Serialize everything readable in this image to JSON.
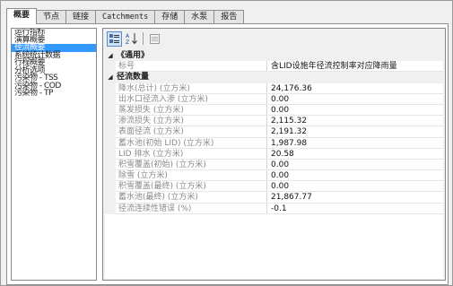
{
  "tabs": [
    "概要",
    "节点",
    "链接",
    "Catchments",
    "存储",
    "水泵",
    "报告"
  ],
  "active_tab_index": 0,
  "left_list": {
    "items": [
      "运行指标",
      "演算概要",
      "径流概要",
      "系统统计数据",
      "行程概要",
      "分析选项",
      "污染物 - TSS",
      "污染物 - COD",
      "污染物 - TP"
    ],
    "selected_index": 2
  },
  "toolbar": {
    "categorized_icon": "categorized-view-icon",
    "alpha_icon": "alphabetical-sort-icon",
    "pages_icon": "property-pages-icon",
    "alpha_glyph": "A↓Z"
  },
  "grid": {
    "cat_general": "《通用》",
    "cat_runoff": "径流数量",
    "rows": [
      {
        "label": "标号",
        "value": "含LID设施年径流控制率对应降雨量"
      },
      {
        "label": "降水(总计) (立方米)",
        "value": "24,176.36"
      },
      {
        "label": "出水口径流入渗 (立方米)",
        "value": "0.00"
      },
      {
        "label": "蒸发损失 (立方米)",
        "value": "0.00"
      },
      {
        "label": "渗流损失 (立方米)",
        "value": "2,115.32"
      },
      {
        "label": "表面径流 (立方米)",
        "value": "2,191.32"
      },
      {
        "label": "蓄水池(初始 LID) (立方米)",
        "value": "1,987.98"
      },
      {
        "label": "LID 排水 (立方米)",
        "value": "20.58"
      },
      {
        "label": "积雪覆盖(初始) (立方米)",
        "value": "0.00"
      },
      {
        "label": "除雪 (立方米)",
        "value": "0.00"
      },
      {
        "label": "积雪覆盖(最终) (立方米)",
        "value": "0.00"
      },
      {
        "label": "蓄水池(最终) (立方米)",
        "value": "21,867.77"
      },
      {
        "label": "径流连续性错误 (%)",
        "value": "-0.1"
      }
    ]
  },
  "colors": {
    "selection": "#3399ff",
    "label_text": "#8a8a8a"
  }
}
